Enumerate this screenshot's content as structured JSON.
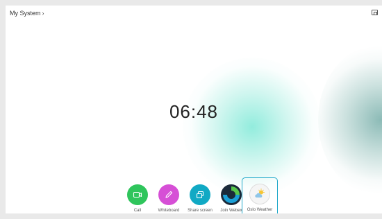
{
  "header": {
    "title": "My System",
    "chevron": "›"
  },
  "clock": {
    "time": "06:48"
  },
  "apps": [
    {
      "label": "Call",
      "color": "#2fc55c",
      "icon": "video-icon"
    },
    {
      "label": "Whiteboard",
      "color": "#d64fd6",
      "icon": "pencil-icon"
    },
    {
      "label": "Share screen",
      "color": "#11a9c4",
      "icon": "share-screen-icon"
    },
    {
      "label": "Join Webex",
      "color": "#1b2a3a",
      "icon": "webex-icon"
    },
    {
      "label": "Oslo Weather",
      "color": "#f5f5f5",
      "icon": "weather-icon",
      "selected": true
    }
  ],
  "colors": {
    "accent": "#1ea7c9"
  }
}
